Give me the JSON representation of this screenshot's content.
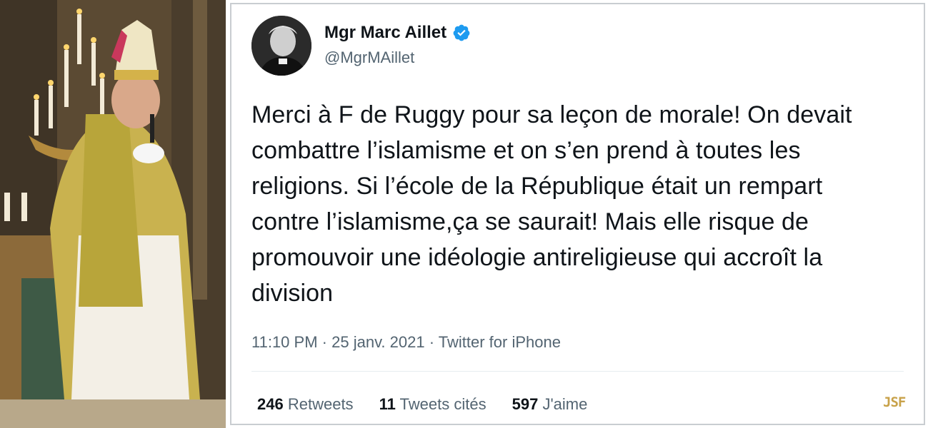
{
  "tweet": {
    "display_name": "Mgr Marc Aillet",
    "handle": "@MgrMAillet",
    "verified": true,
    "text_lines": [
      "Merci à F de Ruggy pour sa leçon de morale! On devait",
      "combattre l’islamisme et on s’en prend à toutes les",
      "religions. Si l’école de la République était un rempart",
      "contre l’islamisme,ça se saurait! Mais elle risque de",
      "promouvoir une idéologie antireligieuse qui accroît la",
      "division"
    ],
    "time": "11:10 PM",
    "date": "25 janv. 2021",
    "source": "Twitter for iPhone",
    "stats": {
      "retweets_count": "246",
      "retweets_label": "Retweets",
      "quotes_count": "11",
      "quotes_label": "Tweets cités",
      "likes_count": "597",
      "likes_label": "J'aime"
    }
  },
  "watermark": "JSF",
  "colors": {
    "text_primary": "#0f1419",
    "text_secondary": "#536471",
    "verified_blue": "#1d9bf0",
    "watermark_gold": "#c8a24a"
  }
}
